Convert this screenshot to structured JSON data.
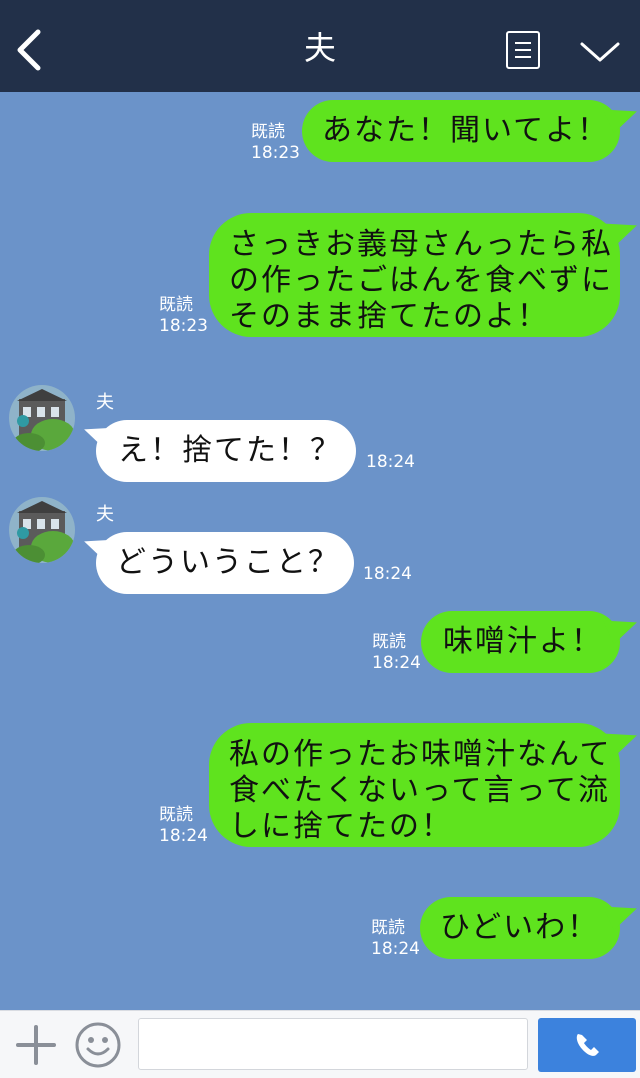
{
  "header": {
    "title": "夫",
    "back_icon": "chevron-left-icon",
    "menu_icon": "list-icon",
    "collapse_icon": "chevron-down-icon",
    "background": "#223049"
  },
  "chat": {
    "background": "#6b93c9",
    "outgoing_color": "#5fe31e",
    "incoming_color": "#ffffff",
    "messages": [
      {
        "direction": "out",
        "text": "あなた！聞いてよ！",
        "read": "既読",
        "time": "18:23"
      },
      {
        "direction": "out",
        "text": "さっきお義母さんったら私\nの作ったごはんを食べずに\nそのまま捨てたのよ！",
        "read": "既読",
        "time": "18:23"
      },
      {
        "direction": "in",
        "sender": "夫",
        "text": "え！捨てた！？",
        "time": "18:24"
      },
      {
        "direction": "in",
        "sender": "夫",
        "text": "どういうこと？",
        "time": "18:24"
      },
      {
        "direction": "out",
        "text": "味噌汁よ！",
        "read": "既読",
        "time": "18:24"
      },
      {
        "direction": "out",
        "text": "私の作ったお味噌汁なんて\n食べたくないって言って流\nしに捨てたの！",
        "read": "既読",
        "time": "18:24"
      },
      {
        "direction": "out",
        "text": "ひどいわ！",
        "read": "既読",
        "time": "18:24"
      }
    ]
  },
  "footer": {
    "plus_icon": "plus-icon",
    "emoji_icon": "smiley-icon",
    "input_value": "",
    "input_placeholder": "",
    "call_icon": "phone-icon",
    "call_color": "#3c82dd"
  }
}
